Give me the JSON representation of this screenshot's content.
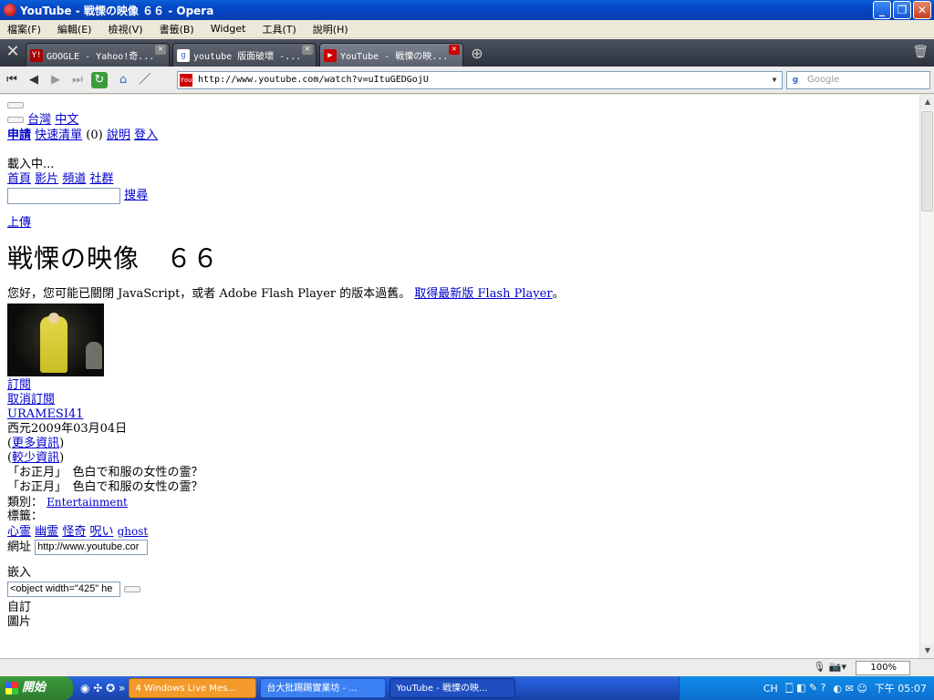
{
  "window": {
    "title": "YouTube - 戦慄の映像 ６６ - Opera"
  },
  "menu": [
    "檔案(F)",
    "編輯(E)",
    "檢視(V)",
    "書籤(B)",
    "Widget",
    "工具(T)",
    "說明(H)"
  ],
  "tabs": [
    {
      "label": "GOOGLE - Yahoo!奇..."
    },
    {
      "label": "youtube 版面破壞 -..."
    },
    {
      "label": "YouTube - 戦慄の映..."
    }
  ],
  "address": {
    "url": "http://www.youtube.com/watch?v=uItuGEDGojU",
    "search_placeholder": "Google"
  },
  "page": {
    "locale_link_1": "台灣",
    "locale_link_2": "中文",
    "signup": "申請",
    "quicklist": "快速清單",
    "quicklist_count": " (0) ",
    "help": "說明",
    "login": "登入",
    "loading": "載入中...",
    "nav_home": "首頁",
    "nav_videos": "影片",
    "nav_channels": "頻道",
    "nav_community": "社群",
    "search_button": "搜尋",
    "upload": "上傳",
    "video_title": "戦慄の映像　６６",
    "flash_notice": "您好，您可能已關閉 JavaScript，或者 Adobe Flash Player 的版本過舊。",
    "flash_link": "取得最新版 Flash Player",
    "flash_end": "。",
    "subscribe": "訂閱",
    "unsubscribe": "取消訂閱",
    "username": "URAMESI41",
    "date": "西元2009年03月04日",
    "more_info_open": "(",
    "more_info": "更多資訊",
    "more_info_close": ")",
    "less_info": "較少資訊",
    "description_1": "「お正月」　色白で和服の女性の霊？",
    "description_2": "「お正月」　色白で和服の女性の霊？",
    "category_label": "類別：",
    "category": "Entertainment",
    "tags_label": "標籤：",
    "tags": [
      "心霊",
      "幽霊",
      "怪奇",
      "呪い",
      "ghost"
    ],
    "url_label": "網址",
    "url_value": "http://www.youtube.cor",
    "embed_label": "嵌入",
    "embed_value": "<object width=\"425\" he",
    "custom": "自訂",
    "picture": "圖片"
  },
  "status": {
    "zoom": "100%"
  },
  "taskbar": {
    "start": "開始",
    "tasks": [
      {
        "label": "4 Windows Live Mes..."
      },
      {
        "label": "台大批踢踢實業坊 - ..."
      },
      {
        "label": "YouTube - 戦慄の映..."
      }
    ],
    "lang": "CH",
    "clock": "下午 05:07"
  }
}
